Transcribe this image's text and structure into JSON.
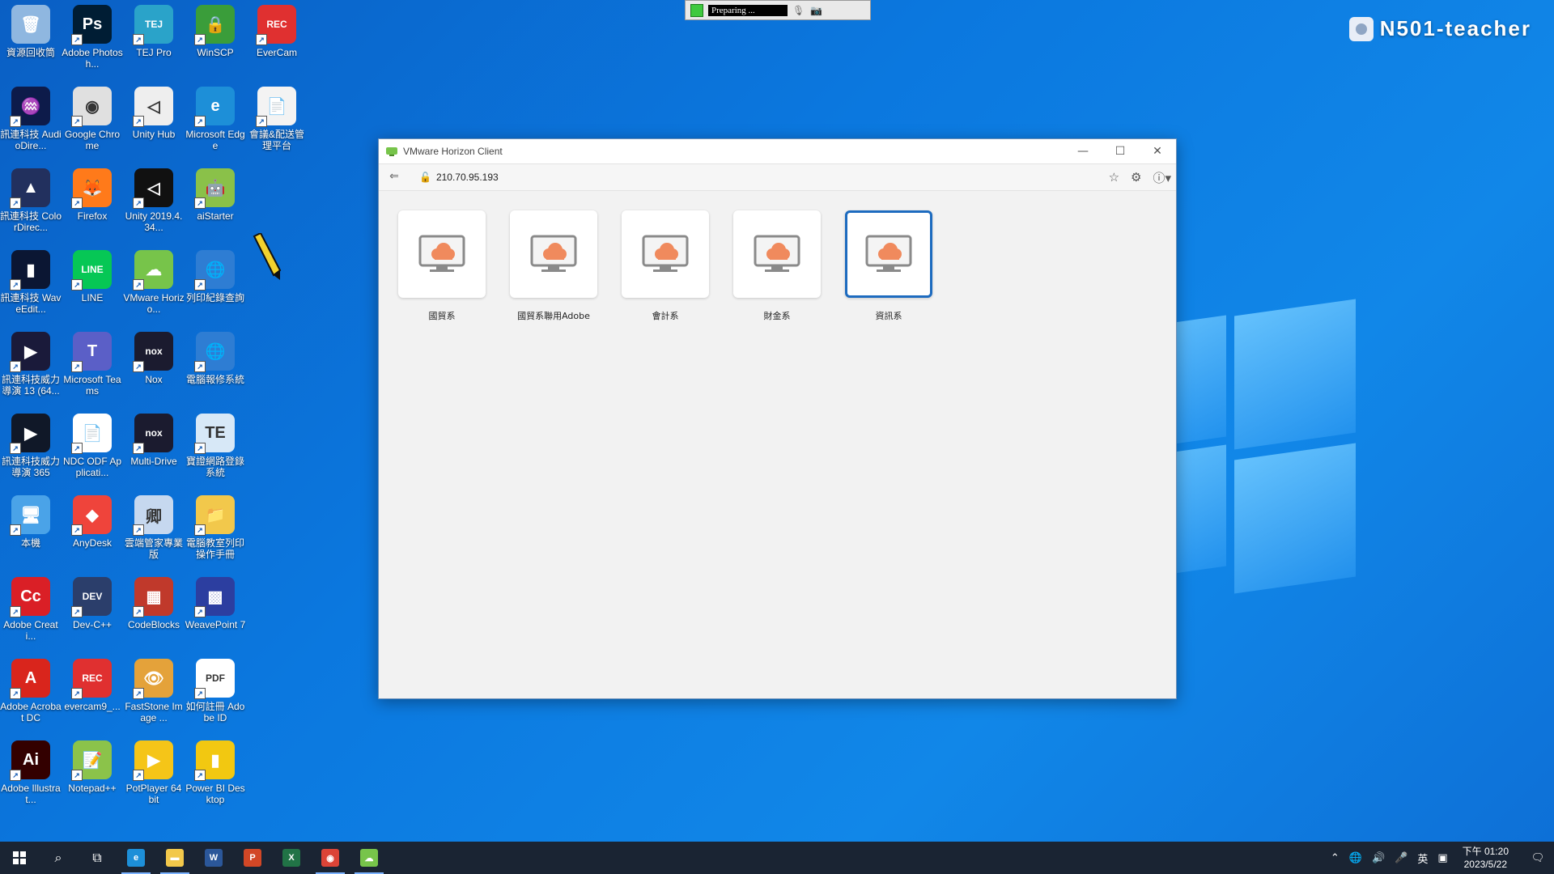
{
  "desktop": {
    "hostname": "N501-teacher",
    "icons": [
      {
        "label": "資源回收筒",
        "icon": "recycle-bin-icon",
        "color": "#8fb7e0",
        "glyph": "🗑"
      },
      {
        "label": "Adobe Photosh...",
        "icon": "photoshop-icon",
        "color": "#001d34",
        "glyph": "Ps"
      },
      {
        "label": "TEJ Pro",
        "icon": "tej-pro-icon",
        "color": "#2aa3c9",
        "glyph": "TEJ"
      },
      {
        "label": "WinSCP",
        "icon": "winscp-icon",
        "color": "#3a9d3a",
        "glyph": "🔒"
      },
      {
        "label": "EverCam",
        "icon": "evercam-icon",
        "color": "#e03030",
        "glyph": "REC"
      },
      {
        "label": "訊連科技 AudioDire...",
        "icon": "audiodirector-icon",
        "color": "#0d1b4a",
        "glyph": "♒"
      },
      {
        "label": "Google Chrome",
        "icon": "chrome-icon",
        "color": "#e0e0e0",
        "glyph": "◉"
      },
      {
        "label": "Unity Hub",
        "icon": "unity-hub-icon",
        "color": "#eeeeee",
        "glyph": "◁"
      },
      {
        "label": "Microsoft Edge",
        "icon": "edge-icon",
        "color": "#1d8fd8",
        "glyph": "e"
      },
      {
        "label": "會議&配送管理平台",
        "icon": "document-icon",
        "color": "#f3f3f3",
        "glyph": "📄"
      },
      {
        "label": "訊連科技 ColorDirec...",
        "icon": "colordirector-icon",
        "color": "#22305e",
        "glyph": "▲"
      },
      {
        "label": "Firefox",
        "icon": "firefox-icon",
        "color": "#ff7a1a",
        "glyph": "🦊"
      },
      {
        "label": "Unity 2019.4.34...",
        "icon": "unity-icon",
        "color": "#111111",
        "glyph": "◁"
      },
      {
        "label": "aiStarter",
        "icon": "aistarter-icon",
        "color": "#8ac149",
        "glyph": "🤖"
      },
      {
        "label": "訊連科技 WaveEdit...",
        "icon": "waveeditor-icon",
        "color": "#0b1633",
        "glyph": "▮"
      },
      {
        "label": "LINE",
        "icon": "line-icon",
        "color": "#06c755",
        "glyph": "LINE"
      },
      {
        "label": "VMware Horizo...",
        "icon": "vmware-horizon-icon",
        "color": "#77c44a",
        "glyph": "☁"
      },
      {
        "label": "列印紀錄查詢",
        "icon": "globe-icon",
        "color": "#2e7dd3",
        "glyph": "🌐"
      },
      {
        "label": "訊連科技威力導演 13 (64...",
        "icon": "powerdirector-icon",
        "color": "#1a1a3a",
        "glyph": "▶"
      },
      {
        "label": "Microsoft Teams",
        "icon": "teams-icon",
        "color": "#5b5fc7",
        "glyph": "T"
      },
      {
        "label": "Nox",
        "icon": "nox-icon",
        "color": "#1b1b2f",
        "glyph": "nox"
      },
      {
        "label": "電腦報修系統",
        "icon": "globe-icon",
        "color": "#2e7dd3",
        "glyph": "🌐"
      },
      {
        "label": "訊連科技威力導演 365",
        "icon": "powerdirector-365-icon",
        "color": "#101828",
        "glyph": "▶"
      },
      {
        "label": "NDC ODF Applicati...",
        "icon": "ndc-odf-icon",
        "color": "#ffffff",
        "glyph": "📄"
      },
      {
        "label": "Multi-Drive",
        "icon": "multi-drive-icon",
        "color": "#1b1b2f",
        "glyph": "nox"
      },
      {
        "label": "寶證網路登錄系統",
        "icon": "tejerp-icon",
        "color": "#d7e8f7",
        "glyph": "TE"
      },
      {
        "label": "本機",
        "icon": "this-pc-icon",
        "color": "#4aa3e8",
        "glyph": "🖥"
      },
      {
        "label": "AnyDesk",
        "icon": "anydesk-icon",
        "color": "#ef443b",
        "glyph": "◆"
      },
      {
        "label": "雲端管家專業版",
        "icon": "cloud-manager-icon",
        "color": "#c6d8ef",
        "glyph": "卿"
      },
      {
        "label": "電腦教室列印操作手冊",
        "icon": "folder-icon",
        "color": "#f2c84b",
        "glyph": "📁"
      },
      {
        "label": "Adobe Creati...",
        "icon": "creative-cloud-icon",
        "color": "#da1f26",
        "glyph": "Cc"
      },
      {
        "label": "Dev-C++",
        "icon": "devcpp-icon",
        "color": "#2b3e6b",
        "glyph": "DEV"
      },
      {
        "label": "CodeBlocks",
        "icon": "codeblocks-icon",
        "color": "#c0392b",
        "glyph": "▦"
      },
      {
        "label": "WeavePoint 7",
        "icon": "weavepoint-icon",
        "color": "#2c3ea0",
        "glyph": "▩"
      },
      {
        "label": "Adobe Acrobat DC",
        "icon": "acrobat-icon",
        "color": "#d9251c",
        "glyph": "A"
      },
      {
        "label": "evercam9_...",
        "icon": "evercam9-icon",
        "color": "#e03030",
        "glyph": "REC"
      },
      {
        "label": "FastStone Image ...",
        "icon": "faststone-icon",
        "color": "#e4a23a",
        "glyph": "👁"
      },
      {
        "label": "如何註冊 Adobe ID",
        "icon": "pdf-icon",
        "color": "#ffffff",
        "glyph": "PDF"
      },
      {
        "label": "Adobe Illustrat...",
        "icon": "illustrator-icon",
        "color": "#330000",
        "glyph": "Ai"
      },
      {
        "label": "Notepad++",
        "icon": "notepadpp-icon",
        "color": "#8bc34a",
        "glyph": "📝"
      },
      {
        "label": "PotPlayer 64 bit",
        "icon": "potplayer-icon",
        "color": "#f5c518",
        "glyph": "▶"
      },
      {
        "label": "Power BI Desktop",
        "icon": "powerbi-icon",
        "color": "#f2c811",
        "glyph": "▮"
      }
    ]
  },
  "recorder": {
    "status": "Preparing ..."
  },
  "vmware": {
    "title": "VMware Horizon Client",
    "address": "210.70.95.193",
    "desktops": [
      {
        "label": "國貿系",
        "selected": false
      },
      {
        "label": "國貿系聯用Adobe",
        "selected": false
      },
      {
        "label": "會計系",
        "selected": false
      },
      {
        "label": "財金系",
        "selected": false
      },
      {
        "label": "資訊系",
        "selected": true
      }
    ]
  },
  "taskbar": {
    "apps": [
      {
        "name": "edge",
        "glyph": "e",
        "color": "#1d8fd8"
      },
      {
        "name": "file-explorer",
        "glyph": "▬",
        "color": "#f2c84b"
      },
      {
        "name": "word",
        "glyph": "W",
        "color": "#2b579a"
      },
      {
        "name": "powerpoint",
        "glyph": "P",
        "color": "#d24726"
      },
      {
        "name": "excel",
        "glyph": "X",
        "color": "#217346"
      },
      {
        "name": "chrome",
        "glyph": "◉",
        "color": "#db4437"
      },
      {
        "name": "vmware-horizon",
        "glyph": "☁",
        "color": "#77c44a"
      }
    ],
    "ime": "英",
    "time": "下午 01:20",
    "date": "2023/5/22"
  }
}
